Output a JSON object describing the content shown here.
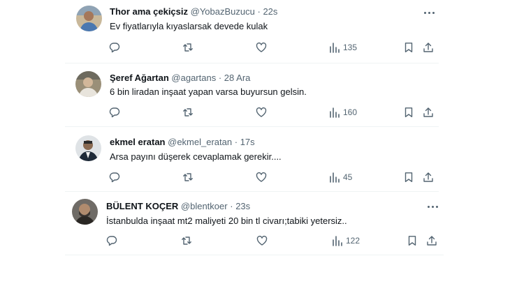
{
  "tweets": [
    {
      "name": "Thor ama çekiçsiz",
      "handle": "@YobazBuzucu",
      "dot": "·",
      "time": "22s",
      "text": "Ev fiyatlarıyla kıyaslarsak devede kulak",
      "views": "135"
    },
    {
      "name": "Şeref Ağartan",
      "handle": "@agartans",
      "dot": "·",
      "time": "28 Ara",
      "text": "6 bin liradan inşaat yapan varsa buyursun gelsin.",
      "views": "160"
    },
    {
      "name": "ekmel eratan",
      "handle": "@ekmel_eratan",
      "dot": "·",
      "time": "17s",
      "text": "Arsa payını düşerek  cevaplamak gerekir....",
      "views": "45"
    },
    {
      "name": "BÜLENT KOÇER",
      "handle": "@blentkoer",
      "dot": "·",
      "time": "23s",
      "text": "İstanbulda inşaat mt2 maliyeti 20 bin tl civarı;tabiki yetersiz..",
      "views": "122"
    }
  ],
  "colors": {
    "text": "#0f1419",
    "muted": "#536471",
    "divider": "#eff3f4"
  },
  "icons": [
    "reply-icon",
    "retweet-icon",
    "like-icon",
    "views-icon",
    "bookmark-icon",
    "share-icon",
    "more-icon"
  ]
}
